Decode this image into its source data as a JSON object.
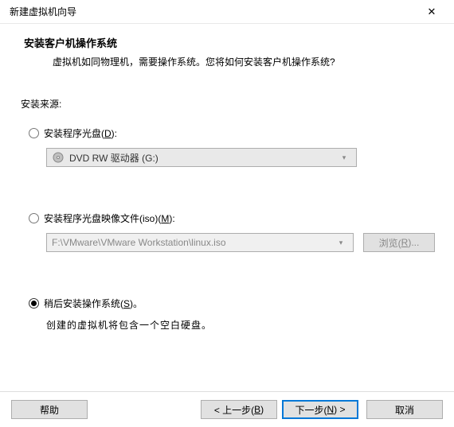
{
  "window": {
    "title": "新建虚拟机向导"
  },
  "header": {
    "title": "安装客户机操作系统",
    "desc": "虚拟机如同物理机，需要操作系统。您将如何安装客户机操作系统?"
  },
  "source": {
    "label": "安装来源:"
  },
  "option_disc": {
    "prefix": "安装程序光盘(",
    "key": "D",
    "suffix": "):",
    "combo_text": "DVD RW 驱动器 (G:)"
  },
  "option_iso": {
    "prefix": "安装程序光盘映像文件(iso)(",
    "key": "M",
    "suffix": "):",
    "combo_text": "F:\\VMware\\VMware Workstation\\linux.iso",
    "browse_prefix": "浏览(",
    "browse_key": "R",
    "browse_suffix": ")..."
  },
  "option_later": {
    "prefix": "稍后安装操作系统(",
    "key": "S",
    "suffix": ")。",
    "desc": "创建的虚拟机将包含一个空白硬盘。"
  },
  "footer": {
    "help": "帮助",
    "back_prefix": "< 上一步(",
    "back_key": "B",
    "back_suffix": ")",
    "next_prefix": "下一步(",
    "next_key": "N",
    "next_suffix": ") >",
    "cancel": "取消"
  }
}
